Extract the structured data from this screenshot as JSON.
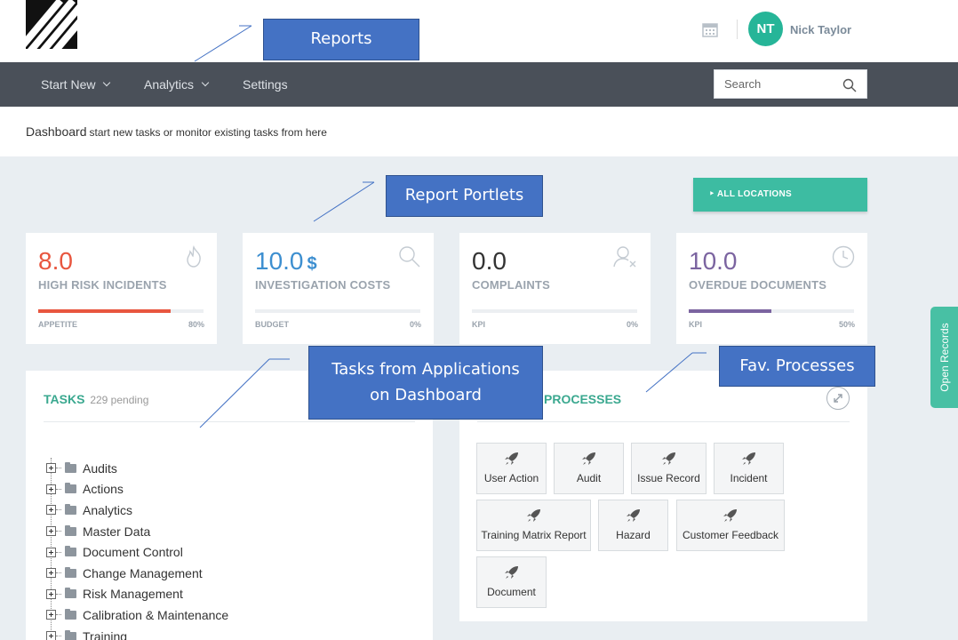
{
  "header": {
    "user_initials": "NT",
    "user_name": "Nick Taylor"
  },
  "nav": {
    "items": [
      {
        "label": "Start New",
        "dropdown": true
      },
      {
        "label": "Analytics",
        "dropdown": true
      },
      {
        "label": "Settings",
        "dropdown": false
      }
    ],
    "search_placeholder": "Search"
  },
  "subheader": {
    "title": "Dashboard",
    "subtitle": "start new tasks or monitor existing tasks from here"
  },
  "locations_button": "‣ ALL LOCATIONS",
  "cards": [
    {
      "value": "8.0",
      "unit": "",
      "label": "HIGH RISK INCIDENTS",
      "foot_left": "APPETITE",
      "foot_right": "80%",
      "progress": 0.8,
      "color": "#e8563f",
      "icon": "fire-icon"
    },
    {
      "value": "10.0",
      "unit": "$",
      "label": "INVESTIGATION COSTS",
      "foot_left": "BUDGET",
      "foot_right": "0%",
      "progress": 0,
      "color": "#3d8fd0",
      "icon": "search-icon"
    },
    {
      "value": "0.0",
      "unit": "",
      "label": "COMPLAINTS",
      "foot_left": "KPI",
      "foot_right": "0%",
      "progress": 0,
      "color": "#333333",
      "icon": "user-x-icon"
    },
    {
      "value": "10.0",
      "unit": "",
      "label": "OVERDUE DOCUMENTS",
      "foot_left": "KPI",
      "foot_right": "50%",
      "progress": 0.5,
      "color": "#7b64a0",
      "icon": "clock-icon"
    }
  ],
  "tasks": {
    "title": "TASKS",
    "pending": "229 pending",
    "items": [
      "Audits",
      "Actions",
      "Analytics",
      "Master Data",
      "Document Control",
      "Change Management",
      "Risk Management",
      "Calibration & Maintenance",
      "Training"
    ]
  },
  "fav": {
    "title": "PROCESSES",
    "items": [
      "User Action",
      "Audit",
      "Issue Record",
      "Incident",
      "Training Matrix Report",
      "Hazard",
      "Customer Feedback",
      "Document"
    ]
  },
  "open_records": "Open Records",
  "callouts": {
    "reports": "Reports",
    "portlets": "Report Portlets",
    "tasks_line1": "Tasks from Applications",
    "tasks_line2": "on Dashboard",
    "fav": "Fav. Processes"
  }
}
